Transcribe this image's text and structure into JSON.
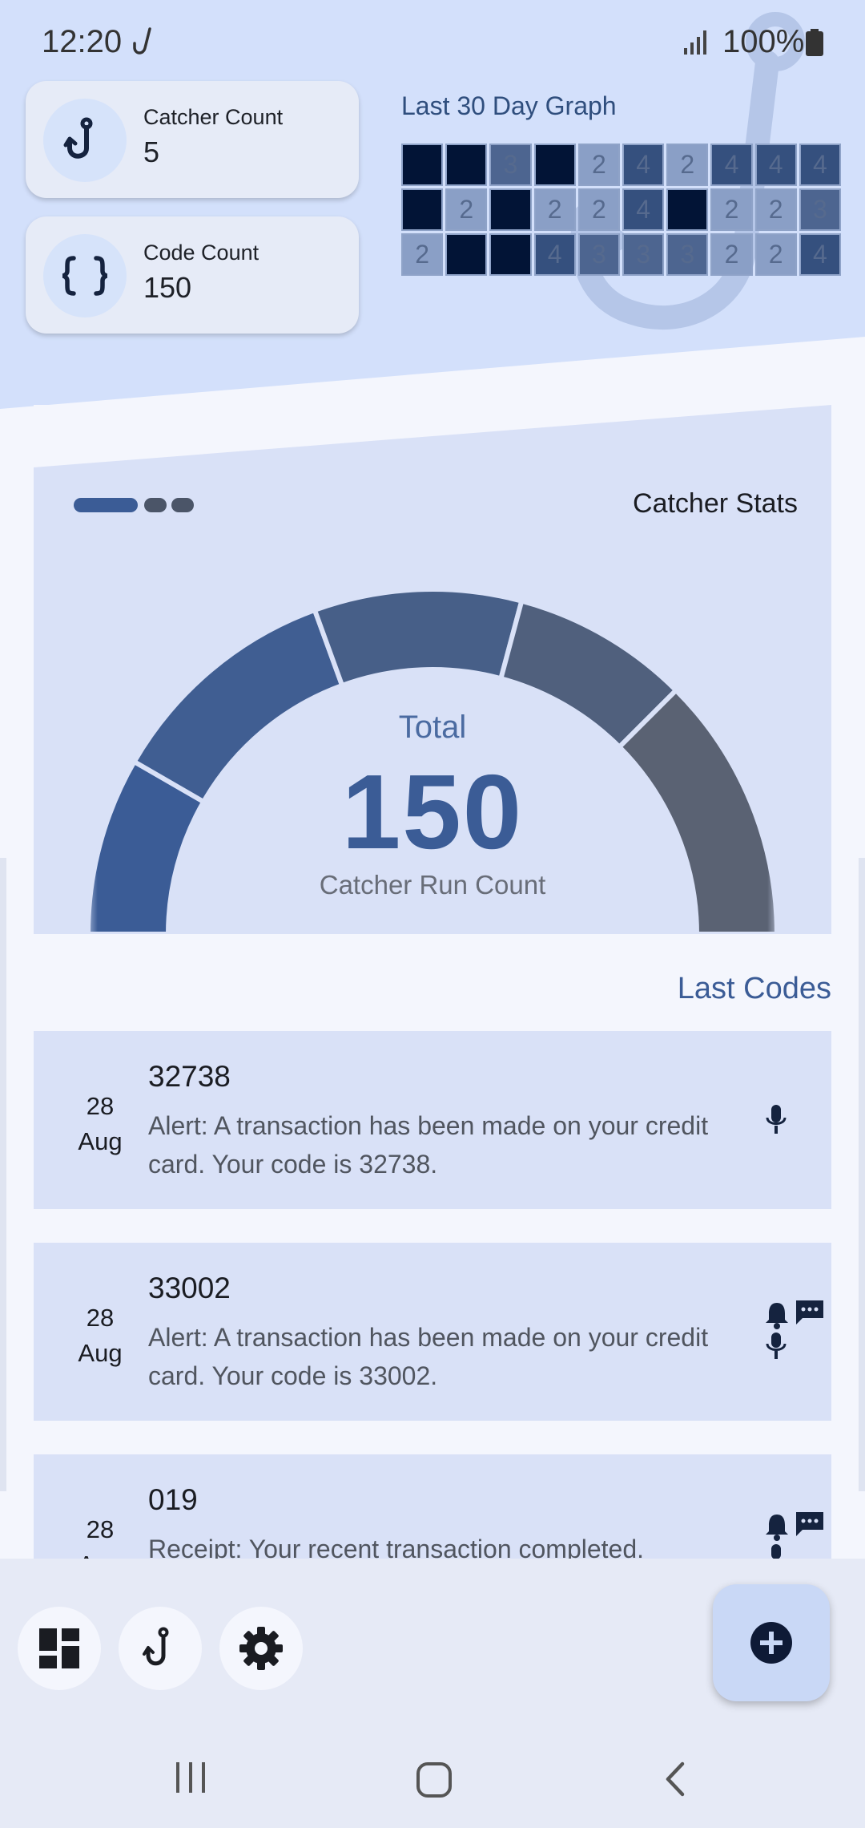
{
  "status_bar": {
    "time": "12:20",
    "battery": "100%"
  },
  "stats": {
    "catcher_count_label": "Catcher Count",
    "catcher_count_value": "5",
    "code_count_label": "Code Count",
    "code_count_value": "150"
  },
  "graph": {
    "title": "Last 30 Day Graph",
    "cells": [
      {
        "label": "",
        "color": "#021436"
      },
      {
        "label": "",
        "color": "#021436"
      },
      {
        "label": "3",
        "color": "#4d6590"
      },
      {
        "label": "",
        "color": "#021436"
      },
      {
        "label": "2",
        "color": "#8a9fc6"
      },
      {
        "label": "4",
        "color": "#35507e"
      },
      {
        "label": "2",
        "color": "#8a9fc6"
      },
      {
        "label": "4",
        "color": "#35507e"
      },
      {
        "label": "4",
        "color": "#35507e"
      },
      {
        "label": "4",
        "color": "#35507e"
      },
      {
        "label": "",
        "color": "#021436"
      },
      {
        "label": "2",
        "color": "#8a9fc6"
      },
      {
        "label": "",
        "color": "#021436"
      },
      {
        "label": "2",
        "color": "#8a9fc6"
      },
      {
        "label": "2",
        "color": "#8a9fc6"
      },
      {
        "label": "4",
        "color": "#35507e"
      },
      {
        "label": "",
        "color": "#021436"
      },
      {
        "label": "2",
        "color": "#8a9fc6"
      },
      {
        "label": "2",
        "color": "#8a9fc6"
      },
      {
        "label": "3",
        "color": "#4d6590"
      },
      {
        "label": "2",
        "color": "#8a9fc6"
      },
      {
        "label": "",
        "color": "#021436"
      },
      {
        "label": "",
        "color": "#021436"
      },
      {
        "label": "4",
        "color": "#35507e"
      },
      {
        "label": "3",
        "color": "#4d6590"
      },
      {
        "label": "3",
        "color": "#4d6590"
      },
      {
        "label": "3",
        "color": "#4d6590"
      },
      {
        "label": "2",
        "color": "#8a9fc6"
      },
      {
        "label": "2",
        "color": "#8a9fc6"
      },
      {
        "label": "4",
        "color": "#35507e"
      }
    ]
  },
  "catcher_stats": {
    "title": "Catcher Stats",
    "total_label": "Total",
    "total_value": "150",
    "subtitle": "Catcher Run Count",
    "segment_colors": [
      "#3b5c96",
      "#405e92",
      "#475f88",
      "#50607d",
      "#5a6273"
    ]
  },
  "last_codes": {
    "title": "Last Codes",
    "items": [
      {
        "day": "28",
        "month": "Aug",
        "code": "32738",
        "message": "Alert: A transaction has been made on your credit card. Your code is 32738.",
        "icons": [
          "mic-icon"
        ]
      },
      {
        "day": "28",
        "month": "Aug",
        "code": "33002",
        "message": "Alert: A transaction has been made on your credit card. Your code is 33002.",
        "icons": [
          "bell-icon",
          "chat-icon",
          "mic-icon"
        ]
      },
      {
        "day": "28",
        "month": "Aug",
        "code": "019",
        "message": "Receipt: Your recent transaction completed.",
        "icons": [
          "bell-icon",
          "chat-icon",
          "mic-icon"
        ]
      }
    ]
  },
  "nav": {
    "items": [
      "dashboard-icon",
      "hook-icon",
      "settings-icon"
    ],
    "fab": "add-circle-icon"
  },
  "colors": {
    "accent": "#3b5c96",
    "header_bg": "#d3e0fb",
    "panel_bg": "#d9e1f7"
  }
}
